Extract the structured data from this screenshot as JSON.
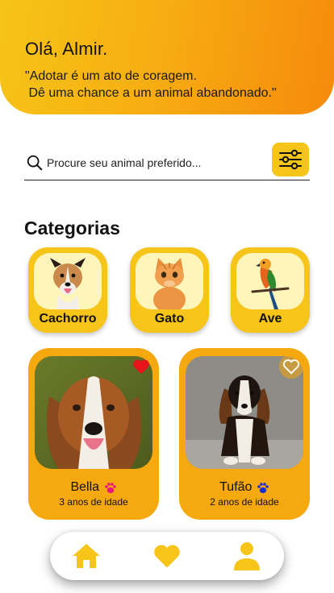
{
  "header": {
    "greeting": "Olá, Almir.",
    "quote_line1": "\"Adotar é um ato de coragem.",
    "quote_line2": " Dê uma chance a um animal abandonado.\""
  },
  "search": {
    "placeholder": "Procure seu animal preferido...",
    "icon": "search-icon",
    "filter_icon": "sliders-icon"
  },
  "categories": {
    "title": "Categorias",
    "items": [
      {
        "label": "Cachorro"
      },
      {
        "label": "Gato"
      },
      {
        "label": "Ave"
      }
    ]
  },
  "pets": [
    {
      "name": "Bella",
      "age": "3 anos de idade",
      "favorite": true,
      "paw_color": "#e8147f"
    },
    {
      "name": "Tufão",
      "age": "2 anos de idade",
      "favorite": false,
      "paw_color": "#1b2bd6"
    }
  ],
  "nav": {
    "items": [
      "home-icon",
      "heart-icon",
      "user-icon"
    ]
  },
  "colors": {
    "accent": "#f7c41a",
    "card": "#f6a80f",
    "header_start": "#f6c418",
    "header_end": "#f68a0c",
    "favorite": "#e8141c"
  }
}
